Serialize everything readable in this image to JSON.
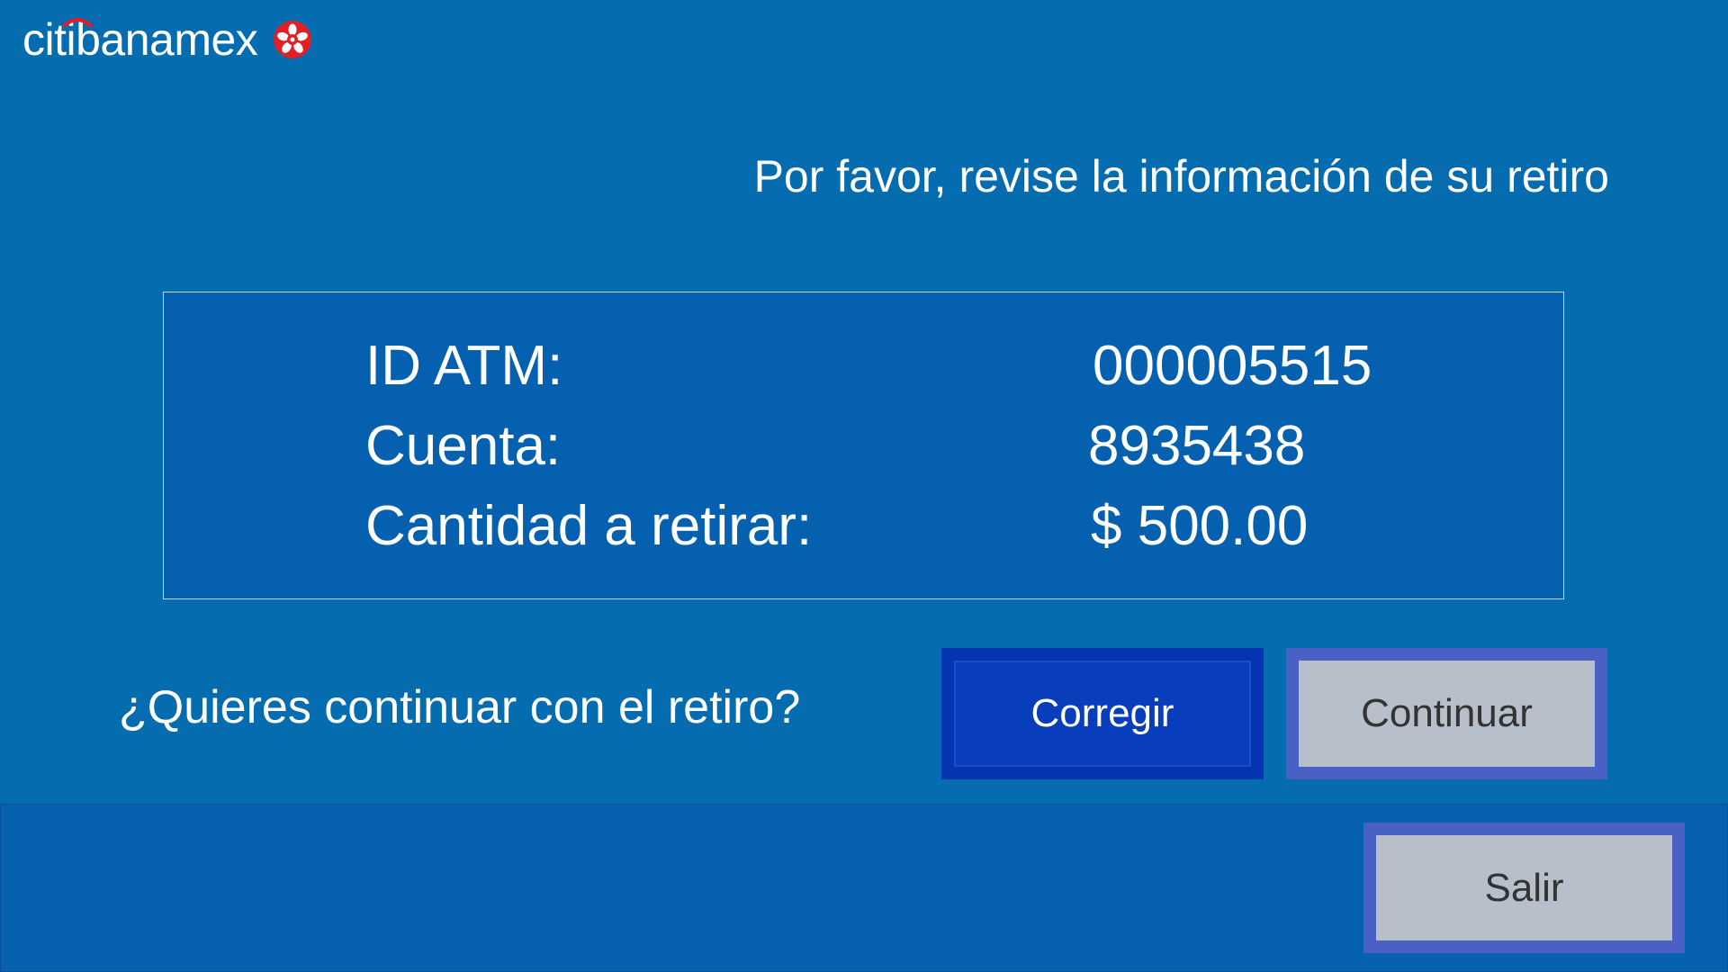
{
  "brand": {
    "name": "citibanamex",
    "logo_icon": "banamex-flower-icon",
    "logo_color": "#e01f26"
  },
  "colors": {
    "background": "#066cb0",
    "panel": "#0560b0",
    "primary_button": "#083dbc",
    "secondary_button": "#b7bfcb",
    "secondary_border": "#4b60c4"
  },
  "screen": {
    "heading": "Por favor, revise la información de su retiro",
    "question": "¿Quieres continuar con el retiro?"
  },
  "info": {
    "rows": [
      {
        "label": "ID ATM:",
        "value": "000005515"
      },
      {
        "label": "Cuenta:",
        "value": "8935438"
      },
      {
        "label": "Cantidad a retirar:",
        "value": "$ 500.00"
      }
    ]
  },
  "actions": {
    "corregir_label": "Corregir",
    "continuar_label": "Continuar",
    "salir_label": "Salir"
  }
}
